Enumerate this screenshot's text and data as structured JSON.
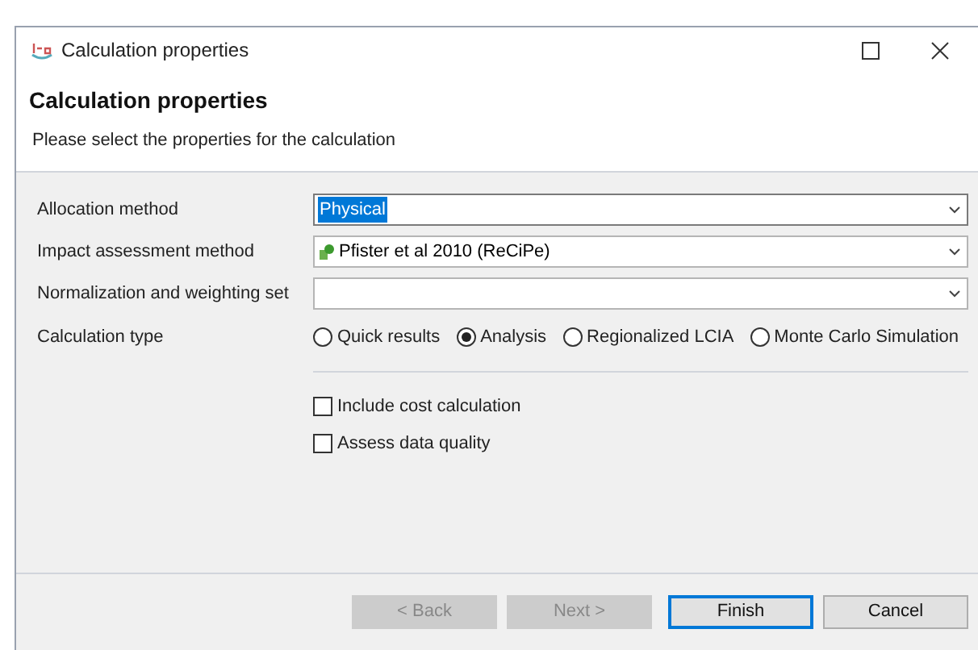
{
  "window": {
    "title": "Calculation properties"
  },
  "header": {
    "title": "Calculation properties",
    "description": "Please select the properties for the calculation"
  },
  "fields": [
    {
      "label": "Allocation method",
      "value": "Physical",
      "selected": true,
      "has_icon": false
    },
    {
      "label": "Impact assessment method",
      "value": "Pfister et al 2010 (ReCiPe)",
      "selected": false,
      "has_icon": true
    },
    {
      "label": "Normalization and weighting set",
      "selected": false,
      "has_icon": false
    }
  ],
  "calculation_type": {
    "label": "Calculation type",
    "options": [
      {
        "label": "Quick results",
        "selected": false
      },
      {
        "label": "Analysis",
        "selected": true
      },
      {
        "label": "Regionalized LCIA",
        "selected": false
      },
      {
        "label": "Monte Carlo Simulation",
        "selected": false
      }
    ]
  },
  "checkboxes": [
    {
      "label": "Include cost calculation",
      "checked": false
    },
    {
      "label": "Assess data quality",
      "checked": false
    }
  ],
  "buttons": [
    {
      "label": "< Back",
      "disabled": true,
      "default": false
    },
    {
      "label": "Next >",
      "disabled": true,
      "default": false
    },
    {
      "label": "Finish",
      "disabled": false,
      "default": true
    },
    {
      "label": "Cancel",
      "disabled": false,
      "default": false
    }
  ]
}
